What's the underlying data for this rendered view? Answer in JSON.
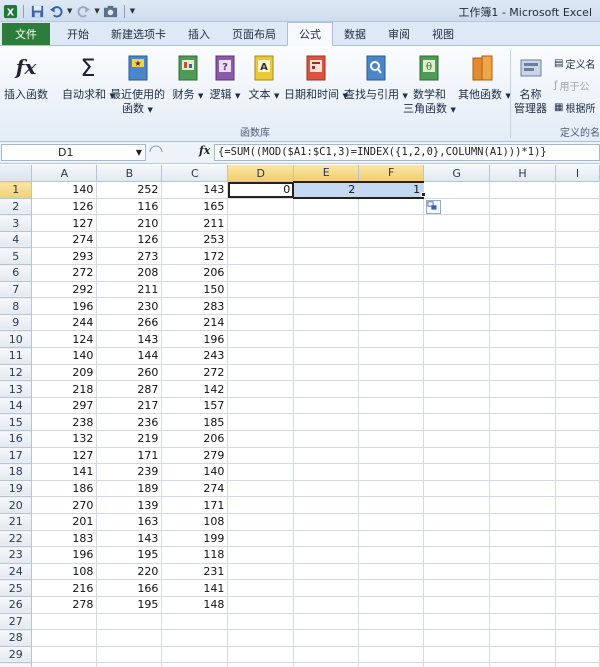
{
  "window": {
    "title": "工作簿1 - Microsoft Excel"
  },
  "tabs": [
    {
      "label": "文件",
      "kind": "file"
    },
    {
      "label": "开始"
    },
    {
      "label": "新建选项卡"
    },
    {
      "label": "插入"
    },
    {
      "label": "页面布局"
    },
    {
      "label": "公式",
      "active": true
    },
    {
      "label": "数据"
    },
    {
      "label": "审阅"
    },
    {
      "label": "视图"
    }
  ],
  "ribbon": {
    "insert_function": "插入函数",
    "autosum": "自动求和",
    "recent_line1": "最近使用的",
    "recent_line2": "函数",
    "financial": "财务",
    "logical": "逻辑",
    "text": "文本",
    "datetime": "日期和时间",
    "lookup": "查找与引用",
    "math_line1": "数学和",
    "math_line2": "三角函数",
    "more": "其他函数",
    "name_mgr_line1": "名称",
    "name_mgr_line2": "管理器",
    "define_name": "定义名",
    "use_in_formula": "用于公",
    "create_from_sel": "根据所",
    "group_function_library": "函数库",
    "group_defined_names": "定义的名"
  },
  "formula_bar": {
    "name_box": "D1",
    "fx": "fx",
    "formula": "{=SUM((MOD($A1:$C1,3)=INDEX({1,2,0},COLUMN(A1)))*1)}"
  },
  "columns": [
    "A",
    "B",
    "C",
    "D",
    "E",
    "F",
    "G",
    "H",
    "I"
  ],
  "rows": [
    {
      "n": "1",
      "a": "140",
      "b": "252",
      "c": "143",
      "d": "0",
      "e": "2",
      "f": "1"
    },
    {
      "n": "2",
      "a": "126",
      "b": "116",
      "c": "165"
    },
    {
      "n": "3",
      "a": "127",
      "b": "210",
      "c": "211"
    },
    {
      "n": "4",
      "a": "274",
      "b": "126",
      "c": "253"
    },
    {
      "n": "5",
      "a": "293",
      "b": "273",
      "c": "172"
    },
    {
      "n": "6",
      "a": "272",
      "b": "208",
      "c": "206"
    },
    {
      "n": "7",
      "a": "292",
      "b": "211",
      "c": "150"
    },
    {
      "n": "8",
      "a": "196",
      "b": "230",
      "c": "283"
    },
    {
      "n": "9",
      "a": "244",
      "b": "266",
      "c": "214"
    },
    {
      "n": "10",
      "a": "124",
      "b": "143",
      "c": "196"
    },
    {
      "n": "11",
      "a": "140",
      "b": "144",
      "c": "243"
    },
    {
      "n": "12",
      "a": "209",
      "b": "260",
      "c": "272"
    },
    {
      "n": "13",
      "a": "218",
      "b": "287",
      "c": "142"
    },
    {
      "n": "14",
      "a": "297",
      "b": "217",
      "c": "157"
    },
    {
      "n": "15",
      "a": "238",
      "b": "236",
      "c": "185"
    },
    {
      "n": "16",
      "a": "132",
      "b": "219",
      "c": "206"
    },
    {
      "n": "17",
      "a": "127",
      "b": "171",
      "c": "279"
    },
    {
      "n": "18",
      "a": "141",
      "b": "239",
      "c": "140"
    },
    {
      "n": "19",
      "a": "186",
      "b": "189",
      "c": "274"
    },
    {
      "n": "20",
      "a": "270",
      "b": "139",
      "c": "171"
    },
    {
      "n": "21",
      "a": "201",
      "b": "163",
      "c": "108"
    },
    {
      "n": "22",
      "a": "183",
      "b": "143",
      "c": "199"
    },
    {
      "n": "23",
      "a": "196",
      "b": "195",
      "c": "118"
    },
    {
      "n": "24",
      "a": "108",
      "b": "220",
      "c": "231"
    },
    {
      "n": "25",
      "a": "216",
      "b": "166",
      "c": "141"
    },
    {
      "n": "26",
      "a": "278",
      "b": "195",
      "c": "148"
    },
    {
      "n": "27"
    },
    {
      "n": "28"
    },
    {
      "n": "29"
    },
    {
      "n": "30"
    }
  ],
  "colors": {
    "file_tab": "#2d7d3a",
    "selection": "#c5d8f1",
    "header_highlight": "#f2cf6e"
  }
}
